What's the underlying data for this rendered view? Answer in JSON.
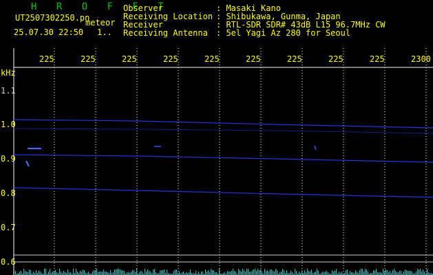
{
  "header": {
    "logo": "H R O F F T",
    "filename": "UT2507302250.pn",
    "mode": "meteor",
    "datetime": "25.07.30 22:50",
    "counter": "1..",
    "info_labels": [
      "Observer",
      "Receiving Location",
      "Receiver",
      "Receiving Antenna"
    ],
    "info_values": [
      ": Masaki Kano",
      ": Shibukawa, Gunma, Japan",
      ": RTL-SDR SDR# 43dB L15 96.7MHz CW",
      ": 5el Yagi Az 280 for Seoul"
    ]
  },
  "time_axis": {
    "ticks": [
      "225",
      "225",
      "225",
      "225",
      "225",
      "225",
      "225",
      "225",
      "225",
      "2300"
    ]
  },
  "freq_axis": {
    "unit": "kHz",
    "ticks": [
      "1.1",
      "1.0",
      "0.9",
      "0.8",
      "0.7",
      "0.6"
    ]
  },
  "colors": {
    "background": "#000000",
    "text": "#ffff00",
    "logo": "#00c800",
    "grid": "#ffffff",
    "trace": "#2a3cff",
    "noise": "#00d8d8"
  }
}
